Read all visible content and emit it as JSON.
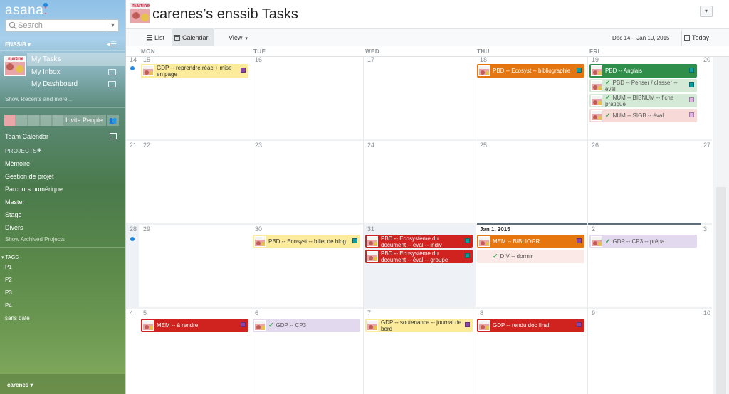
{
  "sidebar": {
    "logo": "asana",
    "search_placeholder": "Search",
    "workspace": "ENSSIB",
    "my_tasks": "My Tasks",
    "my_inbox": "My Inbox",
    "my_dashboard": "My Dashboard",
    "show_recents": "Show Recents and more...",
    "invite_people": "Invite People",
    "team_calendar": "Team Calendar",
    "projects_header": "PROJECTS",
    "projects": [
      "Mémoire",
      "Gestion de projet",
      "Parcours numérique",
      "Master",
      "Stage",
      "Divers"
    ],
    "show_archived": "Show Archived Projects",
    "tags_header": "TAGS",
    "tags": [
      "P1",
      "P2",
      "P3",
      "P4",
      "sans date"
    ],
    "user": "carenes"
  },
  "header": {
    "avatar_text": "martine",
    "title": "carenes’s enssib Tasks"
  },
  "toolbar": {
    "list": "List",
    "calendar": "Calendar",
    "view": "View",
    "date_range": "Dec 14 – Jan 10, 2015",
    "today": "Today"
  },
  "days": [
    "MON",
    "TUE",
    "WED",
    "THU",
    "FRI"
  ],
  "weeks": [
    {
      "nums": [
        "14",
        "15",
        "16",
        "17",
        "18",
        "19",
        "20"
      ]
    },
    {
      "nums": [
        "21",
        "22",
        "23",
        "24",
        "25",
        "26",
        "27"
      ]
    },
    {
      "nums": [
        "28",
        "29",
        "30",
        "31",
        "Jan 1, 2015",
        "2",
        "3"
      ]
    },
    {
      "nums": [
        "4",
        "5",
        "6",
        "7",
        "8",
        "9",
        "10"
      ]
    }
  ],
  "tasks": {
    "w1_mon": "GDP -- reprendre réac + mise en page",
    "w1_thu": "PBD -- Ecosyst -- bibliographie",
    "w1_fri1": "PBD -- Anglais",
    "w1_fri2": "PBD -- Penser / classer -- éval",
    "w1_fri3": "NUM -- BIBNUM -- fiche pratique",
    "w1_fri4": "NUM -- SIGB -- éval",
    "w3_tue": "PBD -- Ecosyst -- billet de blog",
    "w3_wed1": "PBD -- Ecosystème du document -- éval -- indiv",
    "w3_wed2": "PBD -- Ecosystème du document -- éval -- groupe",
    "w3_thu1": "MEM -- BIBLIOGR",
    "w3_thu2": "DIV -- dormir",
    "w3_fri": "GDP -- CP3 -- prépa",
    "w4_mon": "MEM -- à rendre",
    "w4_tue": "GDP -- CP3",
    "w4_wed": "GDP -- soutenance -- journal de bord",
    "w4_thu": "GDP -- rendu doc final"
  },
  "colors": {
    "accent_blue": "#1e88e5",
    "orange": "#e5760f",
    "red": "#d0221f",
    "green": "#2f8f4a",
    "yellow": "#fbeb9a"
  }
}
